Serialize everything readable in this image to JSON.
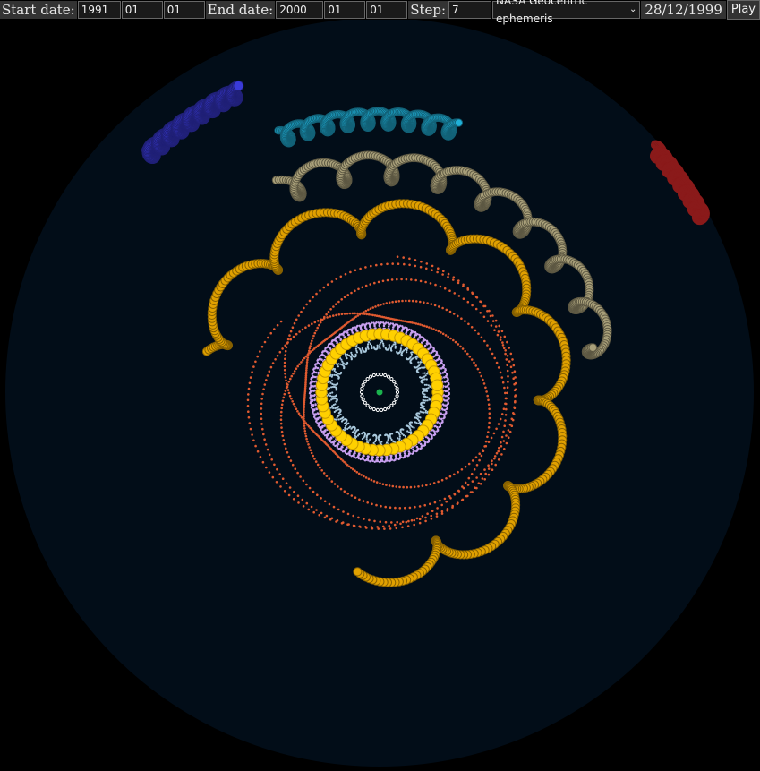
{
  "controls": {
    "start_label": "Start date:",
    "start_year": "1991",
    "start_month": "01",
    "start_day": "01",
    "end_label": "End date:",
    "end_year": "2000",
    "end_month": "01",
    "end_day": "01",
    "step_label": "Step:",
    "step_value": "7",
    "ephemeris_selected": "NASA Geocentric ephemeris",
    "current_date": "28/12/1999",
    "play_label": "Play"
  },
  "colors": {
    "page_background": "#000000",
    "sky_disc": "#020d18",
    "sun": "#ffd000",
    "mercury": "#d98cd9",
    "mercury_small": "#a9c8dc",
    "venus": "#c9a0f0",
    "moon": "#ffffff",
    "earth": "#1ab34d",
    "mars": "#e05a30",
    "jupiter": "#e0a000",
    "saturn": "#a9a07a",
    "uranus": "#20b0d8",
    "neptune": "#3a3ad8",
    "pluto": "#8a1a1a"
  }
}
